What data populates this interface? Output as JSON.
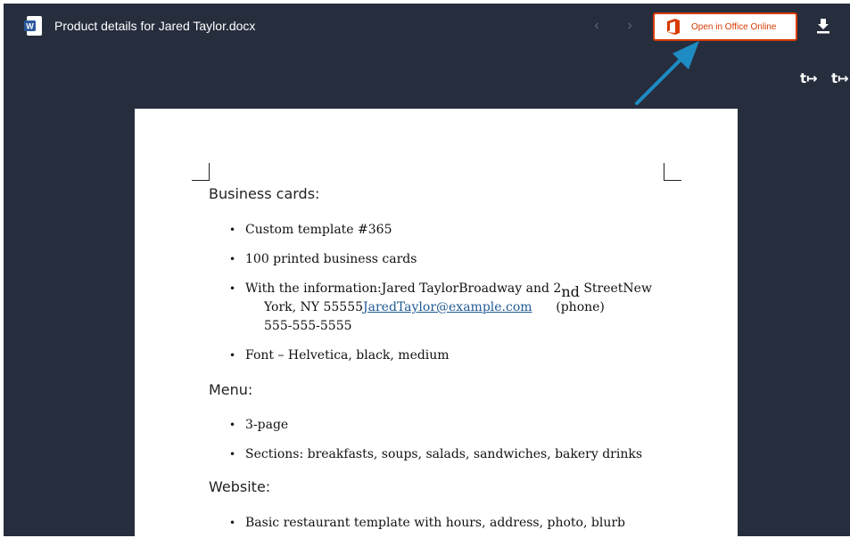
{
  "header": {
    "file_title": "Product details for Jared Taylor.docx",
    "open_office_label": "Open in Office Online"
  },
  "icons": {
    "file": "word-document-icon",
    "prev": "chevron-left-icon",
    "next": "chevron-right-icon",
    "office": "office-logo-icon",
    "download": "download-icon",
    "side_1": "share-icon",
    "side_2": "share-out-icon"
  },
  "colors": {
    "background": "#262d3d",
    "office_accent": "#d83b01",
    "arrow": "#1e8bc3",
    "link": "#1f5a93"
  },
  "document": {
    "business_cards": {
      "heading": "Business cards:",
      "item_1": "Custom template #365",
      "item_2": "100 printed business cards",
      "item_3_a": "With the information:Jared TaylorBroadway and 2",
      "item_3_sub": "nd",
      "item_3_b": " StreetNew",
      "item_3_c": "York, NY 55555",
      "item_3_email": "JaredTaylor@example.com",
      "item_3_d": "(phone)",
      "item_3_e": "555-555-5555",
      "item_4": "Font – Helvetica, black, medium"
    },
    "menu": {
      "heading": "Menu:",
      "item_1": "3-page",
      "item_2": "Sections: breakfasts, soups, salads, sandwiches, bakery drinks"
    },
    "website": {
      "heading": "Website:",
      "item_1": "Basic restaurant template with hours, address, photo, blurb"
    }
  }
}
